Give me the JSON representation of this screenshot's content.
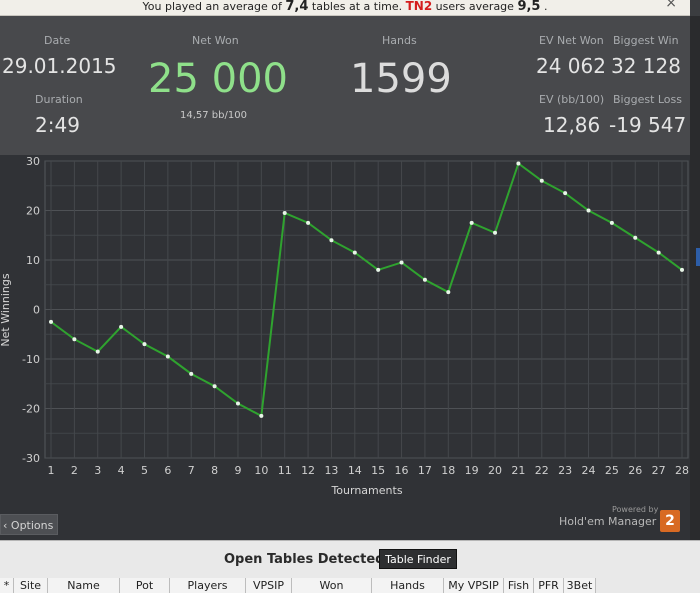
{
  "notice": {
    "pre": "You played an average of ",
    "tables_avg": "7,4",
    "mid": " tables at a time. ",
    "group": "TN2",
    "post": " users average ",
    "group_avg": "9,5",
    "end": " .",
    "close": "×"
  },
  "stats": {
    "date_label": "Date",
    "date_value": "29.01.2015",
    "duration_label": "Duration",
    "duration_value": "2:49",
    "netwon_label": "Net Won",
    "netwon_value": "25 000",
    "bb_per_100": "14,57 bb/100",
    "hands_label": "Hands",
    "hands_value": "1599",
    "ev_netwon_label": "EV Net Won",
    "ev_netwon_value": "24 062",
    "biggest_win_label": "Biggest Win",
    "biggest_win_value": "32 128",
    "ev_bb_label": "EV (bb/100)",
    "ev_bb_value": "12,86",
    "biggest_loss_label": "Biggest Loss",
    "biggest_loss_value": "-19 547",
    "netwon_color": "#8fe08a"
  },
  "chart_data": {
    "type": "line",
    "title": "",
    "xlabel": "Tournaments",
    "ylabel": "Net Winnings",
    "x": [
      1,
      2,
      3,
      4,
      5,
      6,
      7,
      8,
      9,
      10,
      11,
      12,
      13,
      14,
      15,
      16,
      17,
      18,
      19,
      20,
      21,
      22,
      23,
      24,
      25,
      26,
      27,
      28
    ],
    "series": [
      {
        "values": [
          -2.5,
          -6,
          -8.5,
          -3.5,
          -7,
          -9.5,
          -13,
          -15.5,
          -19,
          -21.5,
          19.5,
          17.5,
          14,
          11.5,
          8,
          9.5,
          6,
          3.5,
          17.5,
          15.5,
          29.5,
          26,
          23.5,
          20,
          17.5,
          14.5,
          11.5,
          8
        ]
      }
    ],
    "ylim": [
      -30,
      30
    ],
    "yticks": [
      -30,
      -20,
      -10,
      0,
      10,
      20,
      30
    ],
    "grid": true,
    "line_color": "#2fa32f"
  },
  "footer": {
    "options_label": "Options",
    "powered_by": "Powered by",
    "brand": "Hold'em Manager",
    "brand_badge": "2"
  },
  "bottom": {
    "title": "Open Tables Detected",
    "table_finder": "Table Finder",
    "columns": [
      "*",
      "Site",
      "Name",
      "Pot",
      "Players",
      "VPSIP",
      "Won",
      "Hands",
      "My VPSIP",
      "Fish",
      "PFR",
      "3Bet"
    ]
  }
}
